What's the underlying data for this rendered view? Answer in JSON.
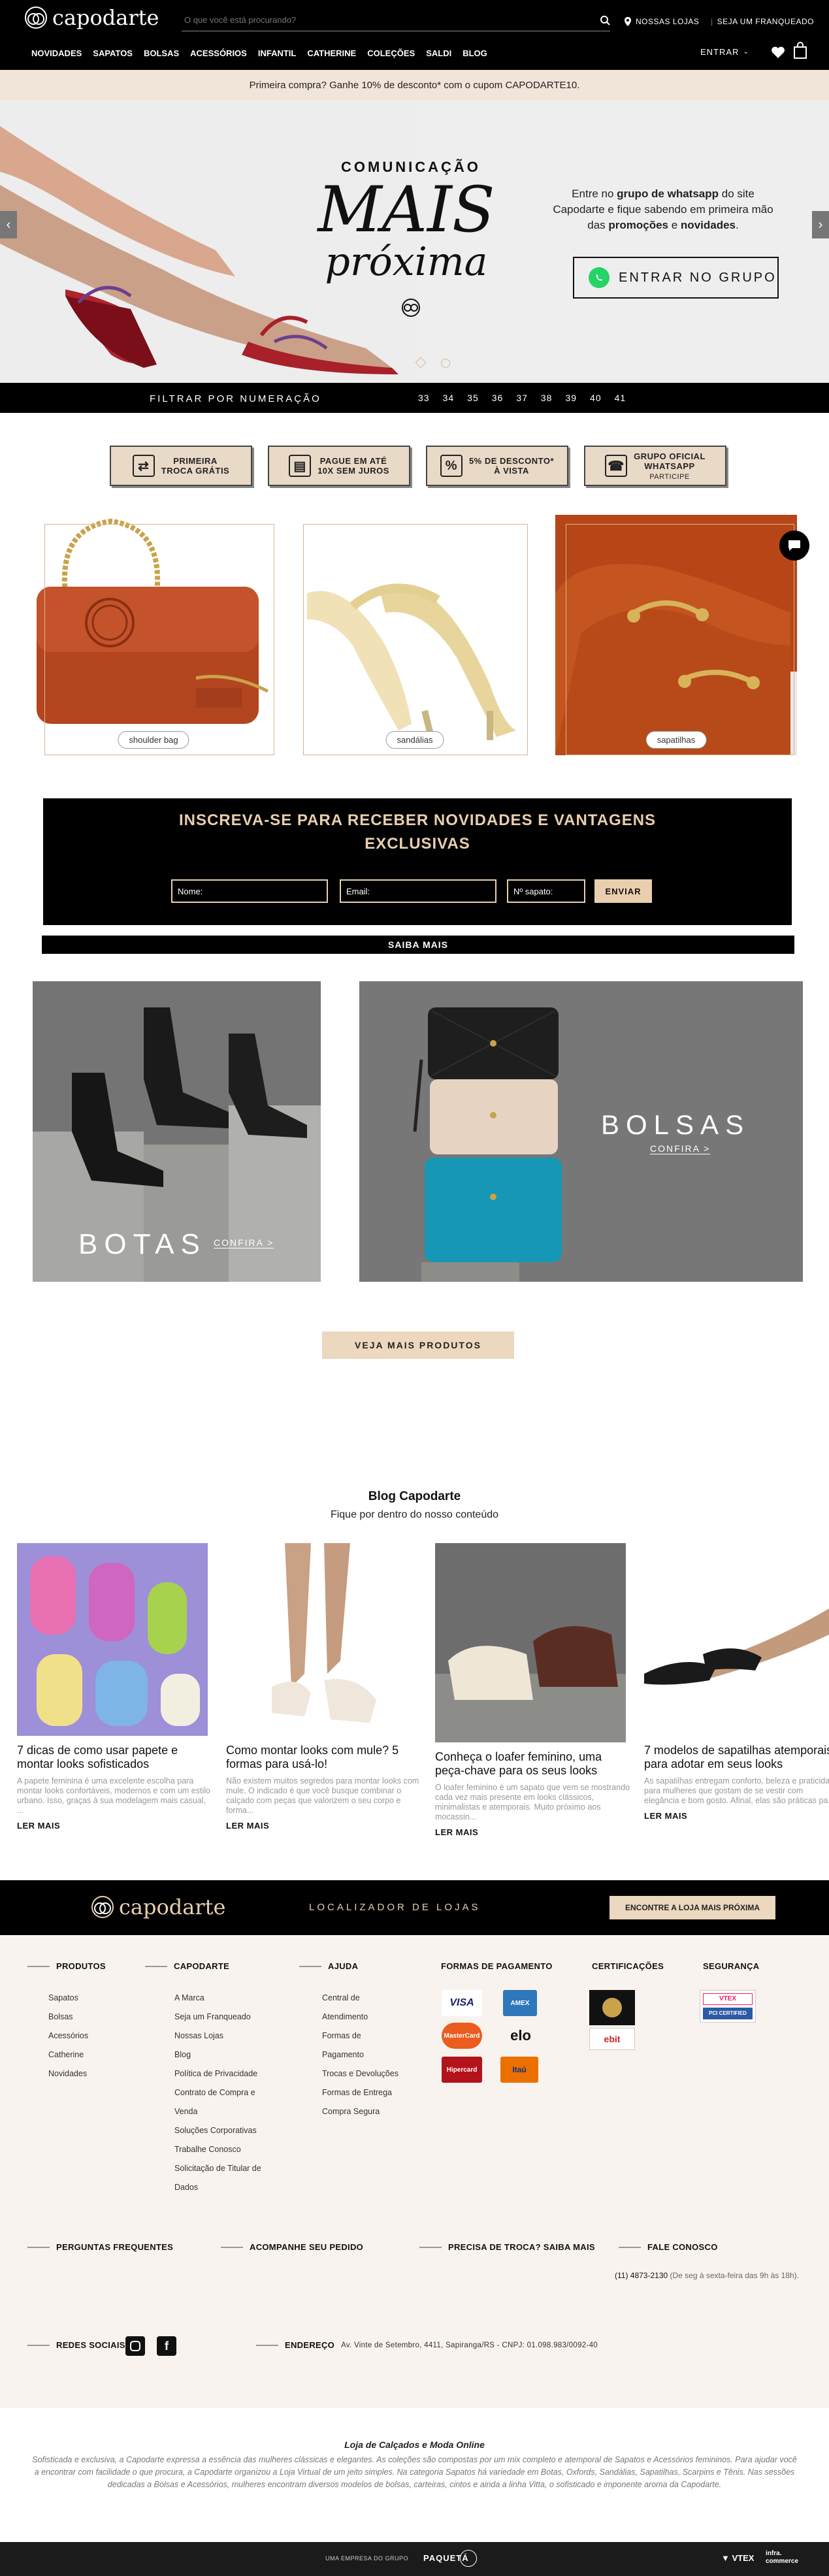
{
  "header": {
    "brand": "capodarte",
    "search_placeholder": "O que você está procurando?",
    "stores_label": "NOSSAS LOJAS",
    "franchise_label": "SEJA UM FRANQUEADO",
    "login_label": "ENTRAR",
    "nav": [
      "NOVIDADES",
      "SAPATOS",
      "BOLSAS",
      "ACESSÓRIOS",
      "INFANTIL",
      "CATHERINE",
      "COLEÇÕES",
      "SALDI",
      "BLOG"
    ]
  },
  "promo_text": "Primeira compra? Ganhe 10% de desconto* com o cupom CAPODARTE10.",
  "hero": {
    "kicker": "COMUNICAÇÃO",
    "title1": "MAIS",
    "title2": "próxima",
    "text1": "Entre no ",
    "text_b1": "grupo de whatsapp",
    "text2": " do site Capodarte e fique sabendo em primeira mão das ",
    "text_b2": "promoções",
    "text3": " e ",
    "text_b3": "novidades",
    "text4": ".",
    "cta": "ENTRAR NO GRUPO"
  },
  "size_filter": {
    "label": "FILTRAR POR NUMERAÇÃO",
    "sizes": [
      "33",
      "34",
      "35",
      "36",
      "37",
      "38",
      "39",
      "40",
      "41"
    ]
  },
  "features": [
    {
      "line1": "PRIMEIRA",
      "line2": "TROCA GRÁTIS",
      "icon": "exchange-icon"
    },
    {
      "line1": "PAGUE EM ATÉ",
      "line2": "10X SEM JUROS",
      "icon": "card-icon"
    },
    {
      "line1": "5% DE DESCONTO*",
      "line2": "À VISTA",
      "icon": "tag-icon"
    },
    {
      "line1": "GRUPO OFICIAL",
      "line2": "WHATSAPP",
      "line3": "PARTICIPE",
      "icon": "phone-icon"
    }
  ],
  "categories": [
    "shoulder bag",
    "sandálias",
    "sapatilhas"
  ],
  "newsletter": {
    "title1": "INSCREVA-SE PARA RECEBER NOVIDADES E VANTAGENS",
    "title2": "EXCLUSIVAS",
    "name_placeholder": "Nome:",
    "email_placeholder": "Email:",
    "size_placeholder": "Nº sapato:",
    "submit": "ENVIAR"
  },
  "saiba_mais": "SAIBA MAIS",
  "banners": {
    "botas": "BOTAS",
    "botas_link": "CONFIRA >",
    "bolsas": "BOLSAS",
    "bolsas_link": "CONFIRA >"
  },
  "more_products": "VEJA MAIS PRODUTOS",
  "blog": {
    "title": "Blog Capodarte",
    "subtitle": "Fique por dentro do nosso conteúdo",
    "read_more": "LER MAIS",
    "posts": [
      {
        "title": "7 dicas de como usar papete e montar looks sofisticados",
        "excerpt": "A papete feminina é uma excelente escolha para montar looks confortáveis, modernos e com um estilo urbano. Isso, graças à sua modelagem mais casual, ..."
      },
      {
        "title": "Como montar looks com mule? 5 formas para usá-lo!",
        "excerpt": "Não existem muitos segredos para montar looks com mule. O indicado é que você busque combinar o calçado com peças que valorizem o seu corpo e forma..."
      },
      {
        "title": "Conheça o loafer feminino, uma peça-chave para os seus looks",
        "excerpt": "O loafer feminino é um sapato que vem se mostrando cada vez mais presente em looks clássicos, minimalistas e atemporais. Muito próximo aos mocassin..."
      },
      {
        "title": "7 modelos de sapatilhas atemporais para adotar em seus looks",
        "excerpt": "As sapatilhas entregam conforto, beleza e praticidade para mulheres que gostam de se vestir com elegância e bom gosto. Afinal, elas são práticas pa..."
      }
    ]
  },
  "store_locator": {
    "label": "LOCALIZADOR DE LOJAS",
    "cta": "ENCONTRE A LOJA MAIS PRÓXIMA"
  },
  "footer": {
    "produtos_title": "PRODUTOS",
    "produtos": [
      "Sapatos",
      "Bolsas",
      "Acessórios",
      "Catherine",
      "Novidades"
    ],
    "capodarte_title": "CAPODARTE",
    "capodarte": [
      "A Marca",
      "Seja um Franqueado",
      "Nossas Lojas",
      "Blog",
      "Política de Privacidade",
      "Contrato de Compra e",
      "Venda",
      "Soluções Corporativas",
      "Trabalhe Conosco",
      "Solicitação de Titular de",
      "Dados"
    ],
    "ajuda_title": "AJUDA",
    "ajuda": [
      "Central de",
      "Atendimento",
      "Formas de",
      "Pagamento",
      "Trocas e Devoluções",
      "Formas de Entrega",
      "Compra Segura"
    ],
    "pagamento_title": "FORMAS DE PAGAMENTO",
    "payments": [
      "VISA",
      "AMEX",
      "MasterCard",
      "elo",
      "Hipercard",
      "Itaú"
    ],
    "cert_title": "CERTIFICAÇÕES",
    "cert_ebit": "ebit",
    "seg_title": "SEGURANÇA",
    "seg_vtex": "VTEX",
    "seg_pci": "PCI CERTIFIED",
    "faq": "PERGUNTAS FREQUENTES",
    "track": "ACOMPANHE SEU PEDIDO",
    "exchange": "PRECISA DE TROCA? SAIBA MAIS",
    "contact": "FALE CONOSCO",
    "phone": "(11) 4873-2130",
    "hours": "(De seg à sexta-feira das 9h às 18h).",
    "social": "REDES SOCIAIS",
    "address_label": "ENDEREÇO",
    "address": "Av. Vinte de Setembro, 4411, Sapiranga/RS - CNPJ: 01.098.983/0092-40"
  },
  "seo": {
    "title1": "Loja de Calçados",
    "title_sep": " e ",
    "title2": "Moda Online",
    "text": "Sofisticada e exclusiva, a Capodarte expressa a essência das mulheres clássicas e elegantes. As coleções são compostas por um mix completo e atemporal de Sapatos e Acessórios femininos. Para ajudar você a encontrar com facilidade o que procura, a Capodarte organizou a Loja Virtual de um jeito simples. Na categoria Sapatos há variedade em Botas, Oxfords, Sandálias, Sapatilhas, Scarpins e Tênis. Nas sessões dedicadas a Bolsas e Acessórios, mulheres encontram diversos modelos de bolsas, carteiras, cintos e ainda a linha Vitta, o sofisticado e imponente aroma da Capodarte."
  },
  "bottom": {
    "group": "UMA EMPRESA DO GRUPO",
    "paqueta": "PAQUETÁ",
    "vtex": "VTEX",
    "infra": "infra. commerce"
  },
  "colors": {
    "beige": "#e9d9c7",
    "gold": "#e9cfae",
    "black": "#000000",
    "footer_bg": "#f8f3ee"
  }
}
